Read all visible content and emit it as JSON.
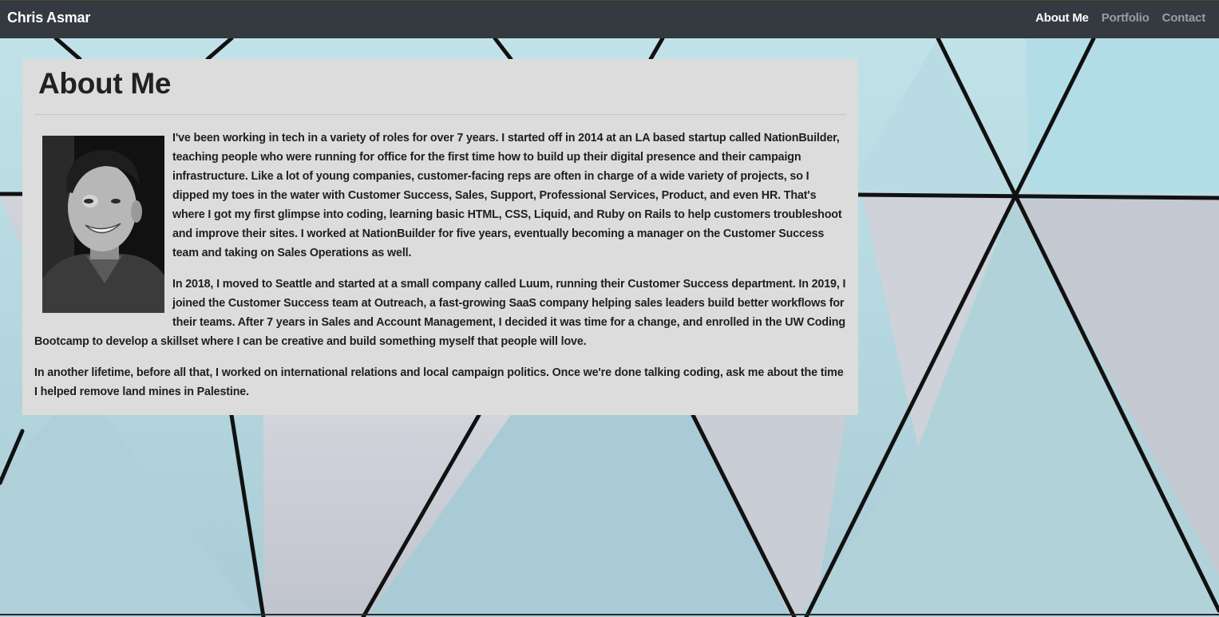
{
  "nav": {
    "brand": "Chris Asmar",
    "links": [
      "About Me",
      "Portfolio",
      "Contact"
    ],
    "active_link": "About Me"
  },
  "about": {
    "heading": "About Me",
    "paragraphs": [
      "I've been working in tech in a variety of roles for over 7 years. I started off in 2014 at an LA based startup called NationBuilder, teaching people who were running for office for the first time how to build up their digital presence and their campaign infrastructure. Like a lot of young companies, customer-facing reps are often in charge of a wide variety of projects, so I dipped my toes in the water with Customer Success, Sales, Support, Professional Services, Product, and even HR. That's where I got my first glimpse into coding, learning basic HTML, CSS, Liquid, and Ruby on Rails to help customers troubleshoot and improve their sites. I worked at NationBuilder for five years, eventually becoming a manager on the Customer Success team and taking on Sales Operations as well.",
      "In 2018, I moved to Seattle and started at a small company called Luum, running their Customer Success department. In 2019, I joined the Customer Success team at Outreach, a fast-growing SaaS company helping sales leaders build better workflows for their teams. After 7 years in Sales and Account Management, I decided it was time for a change, and enrolled in the UW Coding Bootcamp to develop a skillset where I can be creative and build something myself that people will love.",
      "In another lifetime, before all that, I worked on international relations and local campaign politics. Once we're done talking coding, ask me about the time I helped remove land mines in Palestine."
    ]
  },
  "colors": {
    "navbar": "#343a40",
    "card": "#dcdcdc",
    "nav_active": "#ffffff",
    "nav_inactive": "#9a9da1"
  }
}
